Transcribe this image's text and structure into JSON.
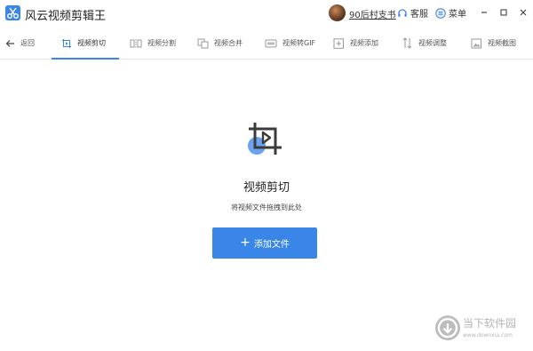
{
  "app": {
    "title": "风云视频剪辑王"
  },
  "titlebar": {
    "user_name": "90后村支书",
    "service_label": "客服",
    "menu_label": "菜单"
  },
  "toolbar": {
    "back_label": "返回",
    "tabs": [
      {
        "label": "视频剪切",
        "icon": "video-cut-icon",
        "active": true
      },
      {
        "label": "视频分割",
        "icon": "video-split-icon",
        "active": false
      },
      {
        "label": "视频合并",
        "icon": "video-merge-icon",
        "active": false
      },
      {
        "label": "视频转GIF",
        "icon": "video-gif-icon",
        "active": false
      },
      {
        "label": "视频添加",
        "icon": "video-add-icon",
        "active": false
      },
      {
        "label": "视频调整",
        "icon": "video-adjust-icon",
        "active": false
      },
      {
        "label": "视频截图",
        "icon": "video-screenshot-icon",
        "active": false
      }
    ]
  },
  "main": {
    "title": "视频剪切",
    "subtitle": "将视频文件拖拽到此处",
    "add_button_label": "添加文件",
    "add_button_icon": "+"
  },
  "watermark": {
    "text": "当下软件园",
    "url": "www.downxia.com"
  },
  "colors": {
    "accent": "#3a86e8",
    "icon_dot": "#6aa3ef",
    "divider": "#e6e6e6"
  }
}
